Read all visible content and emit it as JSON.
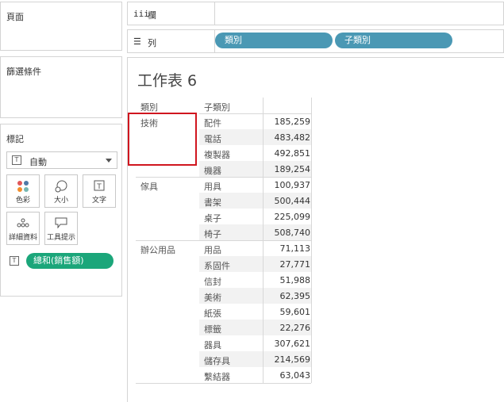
{
  "panels": {
    "pages": "頁面",
    "filters": "篩選條件",
    "marks": "標記"
  },
  "marks": {
    "type": "自動",
    "buttons": [
      "色彩",
      "大小",
      "文字",
      "詳細資料",
      "工具提示"
    ],
    "text_pill": "總和(銷售額)"
  },
  "shelves": {
    "columns_label": "欄",
    "rows_label": "列",
    "row_pills": [
      "類別",
      "子類別"
    ]
  },
  "sheet": {
    "title": "工作表 6",
    "headers": [
      "類別",
      "子類別"
    ],
    "groups": [
      {
        "category": "技術",
        "rows": [
          {
            "sub": "配件",
            "value": "185,259"
          },
          {
            "sub": "電話",
            "value": "483,482"
          },
          {
            "sub": "複製器",
            "value": "492,851"
          },
          {
            "sub": "機器",
            "value": "189,254"
          }
        ]
      },
      {
        "category": "傢具",
        "rows": [
          {
            "sub": "用具",
            "value": "100,937"
          },
          {
            "sub": "書架",
            "value": "500,444"
          },
          {
            "sub": "桌子",
            "value": "225,099"
          },
          {
            "sub": "椅子",
            "value": "508,740"
          }
        ]
      },
      {
        "category": "辦公用品",
        "rows": [
          {
            "sub": "用品",
            "value": "71,113"
          },
          {
            "sub": "系固件",
            "value": "27,771"
          },
          {
            "sub": "信封",
            "value": "51,988"
          },
          {
            "sub": "美術",
            "value": "62,395"
          },
          {
            "sub": "紙張",
            "value": "59,601"
          },
          {
            "sub": "標籤",
            "value": "22,276"
          },
          {
            "sub": "器具",
            "value": "307,621"
          },
          {
            "sub": "儲存具",
            "value": "214,569"
          },
          {
            "sub": "繫結器",
            "value": "63,043"
          }
        ]
      }
    ]
  },
  "colors": {
    "green_pill": "#1ba67a",
    "blue_pill": "#4a98b4",
    "highlight": "#d0161f"
  }
}
